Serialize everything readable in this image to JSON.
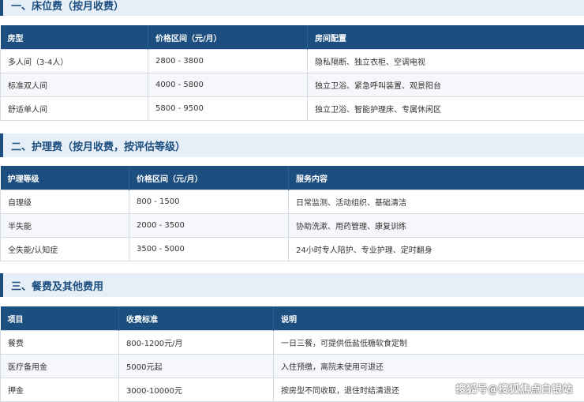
{
  "sections": [
    {
      "title": "一、床位费（按月收费）",
      "headers": [
        "房型",
        "价格区间（元/月）",
        "房间配置"
      ],
      "rows": [
        [
          "多人间（3-4人）",
          "2800 - 3800",
          "隐私隔断、独立衣柜、空调电视"
        ],
        [
          "标准双人间",
          "4000 - 5800",
          "独立卫浴、紧急呼叫装置、观景阳台"
        ],
        [
          "舒适单人间",
          "5800 - 9500",
          "独立卫浴、智能护理床、专属休闲区"
        ]
      ]
    },
    {
      "title": "二、护理费（按月收费，按评估等级）",
      "headers": [
        "护理等级",
        "价格区间（元/月）",
        "服务内容"
      ],
      "rows": [
        [
          "自理级",
          "800 - 1500",
          "日常监测、活动组织、基础清洁"
        ],
        [
          "半失能",
          "2000 - 3500",
          "协助洗漱、用药管理、康复训练"
        ],
        [
          "全失能/认知症",
          "3500 - 5000",
          "24小时专人陪护、专业护理、定时翻身"
        ]
      ]
    },
    {
      "title": "三、餐费及其他费用",
      "headers": [
        "项目",
        "收费标准",
        "说明"
      ],
      "rows": [
        [
          "餐费",
          "800-1200元/月",
          "一日三餐，可提供低盐低糖软食定制"
        ],
        [
          "医疗备用金",
          "5000元起",
          "入住预缴，离院未使用可退还"
        ],
        [
          "押金",
          "3000-10000元",
          "按房型不同收取，退住时结清退还"
        ]
      ]
    }
  ],
  "watermark": "搜狐号@搜狐焦点白银站"
}
